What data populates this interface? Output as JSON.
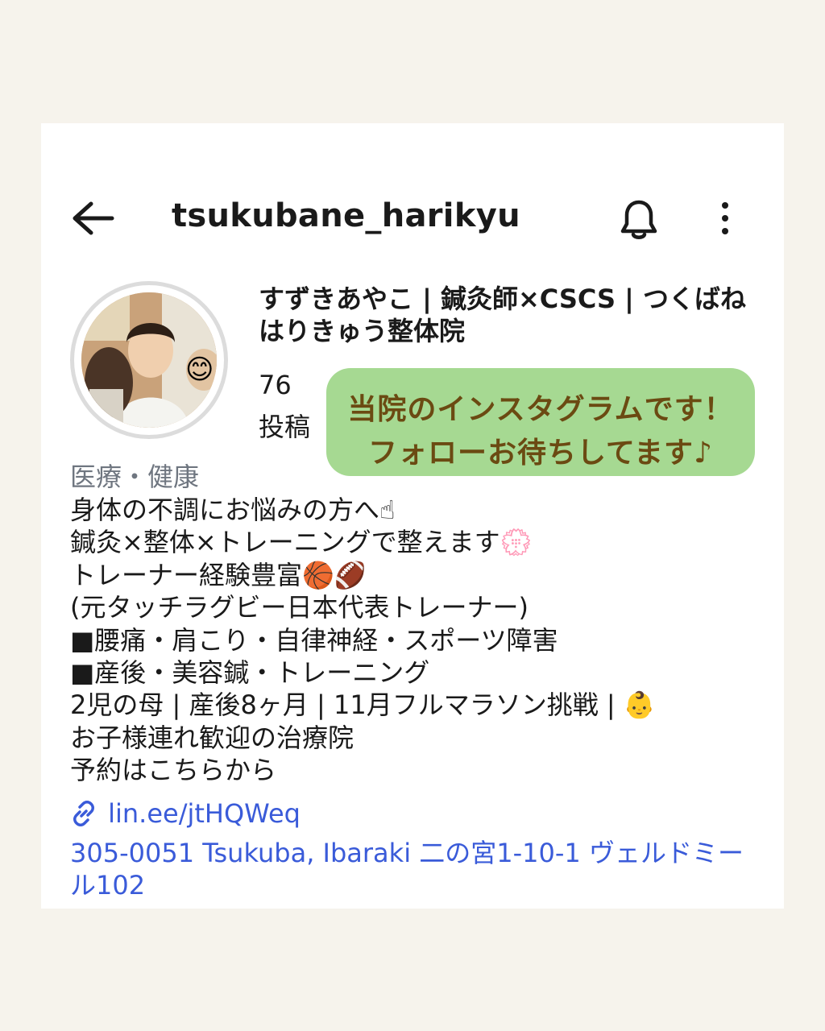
{
  "profile": {
    "handle": "tsukubane_harikyu",
    "display_name": "すずきあやこ | 鍼灸師×CSCS | つくばねはりきゅう整体院",
    "avatar_emoji": "😊",
    "posts_count": "76",
    "posts_label": "投稿",
    "category": "医療・健康",
    "bio_lines": [
      "身体の不調にお悩みの方へ☝",
      "鍼灸×整体×トレーニングで整えます💮",
      "トレーナー経験豊富🏀🏈",
      "(元タッチラグビー日本代表トレーナー)",
      "■腰痛・肩こり・自律神経・スポーツ障害",
      "■産後・美容鍼・トレーニング",
      "2児の母 | 産後8ヶ月 | 11月フルマラソン挑戦 | 👶",
      "お子様連れ歓迎の治療院",
      "予約はこちらから"
    ],
    "link": "lin.ee/jtHQWeq",
    "address": "305-0051 Tsukuba, Ibaraki 二の宮1-10-1 ヴェルドミール102"
  },
  "promo": {
    "line1": "当院のインスタグラムです！",
    "line2": "フォローお待ちしてます♪"
  },
  "icons": {
    "back": "arrow-left-icon",
    "bell": "bell-icon",
    "more": "more-vertical-icon",
    "link": "link-icon"
  },
  "colors": {
    "page_background": "#f6f3ec",
    "link": "#3a5bd9",
    "promo_background": "#a6d992",
    "promo_text": "#6b4a12",
    "category": "#6f7680"
  }
}
